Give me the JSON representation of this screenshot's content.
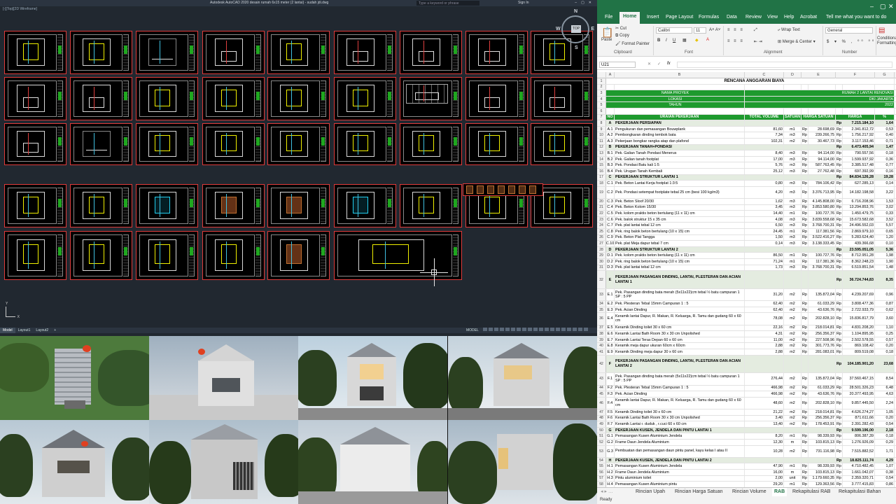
{
  "autocad": {
    "title": "Autodesk AutoCAD 2020   desain rumah 6x15 meter (2 lantai) - sudah jdi.dwg",
    "search_placeholder": "Type a keyword or phrase",
    "user": "Sign In",
    "view_label": "[-][Top][2D Wireframe]",
    "compass": {
      "top": "TOP",
      "n": "N",
      "s": "S",
      "e": "E",
      "w": "W"
    },
    "ucs_x": "X",
    "ucs_y": "Y",
    "layout_tabs": [
      "Model",
      "Layout1",
      "Layout2",
      "+"
    ],
    "model_label": "MODEL"
  },
  "excel": {
    "tabs": [
      "File",
      "Home",
      "Insert",
      "Page Layout",
      "Formulas",
      "Data",
      "Review",
      "View",
      "Help",
      "Acrobat",
      "Tell me what you want to do"
    ],
    "ribbon": {
      "cut": "Cut",
      "copy": "Copy",
      "format_painter": "Format Painter",
      "paste": "Paste",
      "clipboard": "Clipboard",
      "font_name": "Calibri",
      "font_size": "11",
      "font": "Font",
      "bold": "B",
      "italic": "I",
      "underline": "U",
      "alignment": "Alignment",
      "wrap_text": "Wrap Text",
      "merge_center": "Merge & Center",
      "number_format": "General",
      "number": "Number",
      "conditional": "Conditional Formatting"
    },
    "name_box": "U21",
    "fx": "fx",
    "columns": [
      "A",
      "B",
      "C",
      "D",
      "E",
      "F",
      "G"
    ],
    "sheet_tabs": [
      "Rincian Upah",
      "Rincian Harga Satuan",
      "Rincian Volume",
      "RAB",
      "Rekapitulasi RAB",
      "Rekapitulasi Bahan"
    ],
    "status": "Ready",
    "rows": [
      {
        "n": "1",
        "kind": "t",
        "b": "RENCANA ANGGARAN BIAYA"
      },
      {
        "n": "2",
        "kind": ""
      },
      {
        "n": "3",
        "kind": "g",
        "a": "NAMA PROYEK",
        "b": "",
        "c": "RUMAH 2 LANTAI RENOVASI"
      },
      {
        "n": "4",
        "kind": "g",
        "a": "LOKASI",
        "b": "",
        "c": "DKI JAKARTA"
      },
      {
        "n": "5",
        "kind": "g",
        "a": "TAHUN",
        "b": "",
        "c": "2022"
      },
      {
        "n": "6",
        "kind": ""
      },
      {
        "n": "7",
        "kind": "h",
        "a": "NO",
        "b": "URAIAN PEKERJAAN",
        "c": "TOTAL VOLUME",
        "d": "SATUAN",
        "e": "HARGA SATUAN",
        "f": "HARGA",
        "g": "%"
      },
      {
        "n": "8",
        "kind": "s",
        "a": "A",
        "b": "PEKERJAAN PERSIAPAN",
        "e": "",
        "rp2": "Rp",
        "f": "7.215.184,10",
        "g": "1,64"
      },
      {
        "n": "9",
        "a": "A.1",
        "b": "Pengukuran dan pemasangan Bouwplank",
        "c": "81,60",
        "d": "m1",
        "rp": "Rp",
        "e": "28.698,69",
        "rp2": "Rp",
        "f": "2.341.812,72",
        "g": "0,53"
      },
      {
        "n": "10",
        "a": "A.2",
        "b": "Pembongkaran dinding tembok bata",
        "c": "7,34",
        "d": "m3",
        "rp": "Rp",
        "e": "239.266,75",
        "rp2": "Rp",
        "f": "1.756.217,92",
        "g": "0,40"
      },
      {
        "n": "11",
        "a": "A.3",
        "b": "Pekerjaan bongkar rangka atap dan plafond",
        "c": "102,31",
        "d": "m2",
        "rp": "Rp",
        "e": "30.467,73",
        "rp2": "Rp",
        "f": "3.117.153,46",
        "g": "0,71"
      },
      {
        "n": "12",
        "kind": "s",
        "a": "B",
        "b": "PEKERJAAN TANAH+PONDASI",
        "rp2": "Rp",
        "f": "6.473.405,94",
        "g": "1,47"
      },
      {
        "n": "13",
        "a": "B.1",
        "b": "Pek. Galian Tanah Pondasi Menerus",
        "c": "8,40",
        "d": "m3",
        "rp": "Rp",
        "e": "94.114,00",
        "rp2": "Rp",
        "f": "790.557,56",
        "g": "0,18"
      },
      {
        "n": "14",
        "a": "B.2",
        "b": "Pek. Galian tanah footplat",
        "c": "17,00",
        "d": "m3",
        "rp": "Rp",
        "e": "94.114,00",
        "rp2": "Rp",
        "f": "1.599.937,92",
        "g": "0,36"
      },
      {
        "n": "15",
        "a": "B.3",
        "b": "Pek. Pondasi Batu kali 1:5",
        "c": "5,76",
        "d": "m3",
        "rp": "Rp",
        "e": "587.763,45",
        "rp2": "Rp",
        "f": "3.385.517,48",
        "g": "0,77"
      },
      {
        "n": "16",
        "a": "B.4",
        "b": "Pek. Urugan Tanah Kembali",
        "c": "25,12",
        "d": "m3",
        "rp": "Rp",
        "e": "27.762,48",
        "rp2": "Rp",
        "f": "697.392,99",
        "g": "0,16"
      },
      {
        "n": "17",
        "kind": "s",
        "a": "C",
        "b": "PEKERJAAN STRUKTUR LANTAI 1",
        "rp2": "Rp",
        "f": "84.834.126,28",
        "g": "19,28"
      },
      {
        "n": "18",
        "a": "C.1",
        "b": "Pek. Beton Lantai Kerja footplat 1:3:5",
        "c": "0,80",
        "d": "m3",
        "rp": "Rp",
        "e": "784.106,42",
        "rp2": "Rp",
        "f": "627.285,13",
        "g": "0,14"
      },
      {
        "n": "19",
        "kind": "wrap",
        "h": 2,
        "a": "C.2",
        "b": "Pek. Pondasi setempat footplate tebal 25 cm (besi 100 kg/m3)",
        "c": "4,20",
        "d": "m3",
        "rp": "Rp",
        "e": "3.376.713,95",
        "rp2": "Rp",
        "f": "14.182.198,58",
        "g": "3,22"
      },
      {
        "n": "20",
        "a": "C.3",
        "b": "Pek. Beton Sloof 20/30",
        "c": "1,62",
        "d": "m3",
        "rp": "Rp",
        "e": "4.145.808,00",
        "rp2": "Rp",
        "f": "6.716.208,96",
        "g": "1,53"
      },
      {
        "n": "21",
        "a": "C.4",
        "b": "Pek. Beton Kolom 15/30",
        "c": "3,45",
        "d": "m3",
        "rp": "Rp",
        "e": "3.853.580,80",
        "rp2": "Rp",
        "f": "13.294.853,76",
        "g": "3,02"
      },
      {
        "n": "22",
        "a": "C.5",
        "b": "Pek. kolom praktis beton bertulang (11 x 11) cm",
        "c": "14,40",
        "d": "m1",
        "rp": "Rp",
        "e": "100.727,76",
        "rp2": "Rp",
        "f": "1.450.479,75",
        "g": "0,33"
      },
      {
        "n": "23",
        "a": "C.6",
        "b": "Pek. balok struktur 15 x 35 cm",
        "c": "4,08",
        "d": "m3",
        "rp": "Rp",
        "e": "3.839.558,68",
        "rp2": "Rp",
        "f": "15.673.582,68",
        "g": "3,52"
      },
      {
        "n": "24",
        "a": "C.7",
        "b": "Pek. plat lantai tebal 12 cm",
        "c": "6,50",
        "d": "m3",
        "rp": "Rp",
        "e": "3.768.700,31",
        "rp2": "Rp",
        "f": "24.496.552,03",
        "g": "5,57"
      },
      {
        "n": "25",
        "a": "C.8",
        "b": "Pek. ring balok beton bertulang (10 x 15) cm",
        "c": "24,45",
        "d": "m1",
        "rp": "Rp",
        "e": "117.381,56",
        "rp2": "Rp",
        "f": "2.869.979,10",
        "g": "0,65"
      },
      {
        "n": "26",
        "a": "C.9",
        "b": "Pek. Beton Plat Tangga",
        "c": "1,50",
        "d": "m3",
        "rp": "Rp",
        "e": "3.522.416,27",
        "rp2": "Rp",
        "f": "5.283.624,40",
        "g": "1,20"
      },
      {
        "n": "27",
        "a": "C.10",
        "b": "Pek. plat Meja dapur tebal 7 cm",
        "c": "0,14",
        "d": "m3",
        "rp": "Rp",
        "e": "3.138.333,45",
        "rp2": "Rp",
        "f": "439.366,68",
        "g": "0,10"
      },
      {
        "n": "28",
        "kind": "s",
        "a": "D",
        "b": "PEKERJAAN STRUKTUR LANTAI 2",
        "rp2": "Rp",
        "f": "23.595.051,05",
        "g": "5,36"
      },
      {
        "n": "29",
        "a": "D.1",
        "b": "Pek. kolom praktis beton bertulang (11 x 11) cm",
        "c": "86,50",
        "d": "m1",
        "rp": "Rp",
        "e": "100.727,76",
        "rp2": "Rp",
        "f": "8.712.951,28",
        "g": "1,98"
      },
      {
        "n": "30",
        "a": "D.2",
        "b": "Pek. ring balok beton bertulang (10 x 15) cm",
        "c": "71,24",
        "d": "m1",
        "rp": "Rp",
        "e": "117.381,36",
        "rp2": "Rp",
        "f": "8.362.248,23",
        "g": "1,90"
      },
      {
        "n": "31",
        "a": "D.3",
        "b": "Pek. plat lantai tebal 12 cm",
        "c": "1,73",
        "d": "m3",
        "rp": "Rp",
        "e": "3.768.700,31",
        "rp2": "Rp",
        "f": "6.519.851,54",
        "g": "1,48"
      },
      {
        "n": "32",
        "kind": "s wrap",
        "h": 3,
        "a": "E",
        "b": "PEKERJAAN PASANGAN DINDING, LANTAI, PLESTERAN DAN ACIAN LANTAI 1",
        "rp2": "Rp",
        "f": "36.724.744,83",
        "g": "8,35"
      },
      {
        "n": "33",
        "kind": "wrap",
        "h": 2,
        "a": "E.1",
        "b": "Pek. Pasangan dinding bata merah (5x11x22)cm tebal ½ batu campuran 1 SP : 5 PP",
        "c": "31,20",
        "d": "m2",
        "rp": "Rp",
        "e": "135.872,04",
        "rp2": "Rp",
        "f": "4.239.207,69",
        "g": "0,96"
      },
      {
        "n": "34",
        "a": "E.2",
        "b": "Pek. Plesteran Tebal 15mm Campuran 1 : 5",
        "c": "62,40",
        "d": "m2",
        "rp": "Rp",
        "e": "61.033,29",
        "rp2": "Rp",
        "f": "3.808.477,36",
        "g": "0,87"
      },
      {
        "n": "35",
        "a": "E.3",
        "b": "Pek. Acian Dinding",
        "c": "62,40",
        "d": "m2",
        "rp": "Rp",
        "e": "43.636,76",
        "rp2": "Rp",
        "f": "2.722.933,79",
        "g": "0,62"
      },
      {
        "n": "36",
        "kind": "wrap",
        "h": 2,
        "a": "E.4",
        "b": "Keramik lantai Dapur, R. Makan, R. Keluarga, R. Tamu dan gudang 60 x 60 cm",
        "c": "78,08",
        "d": "m2",
        "rp": "Rp",
        "e": "202.828,10",
        "rp2": "Rp",
        "f": "15.836.817,79",
        "g": "3,60"
      },
      {
        "n": "37",
        "a": "E.5",
        "b": "Keramik Dinding toilet 30 x 60 cm",
        "c": "22,16",
        "d": "m2",
        "rp": "Rp",
        "e": "218.014,81",
        "rp2": "Rp",
        "f": "4.831.208,20",
        "g": "1,10"
      },
      {
        "n": "38",
        "a": "E.6",
        "b": "Keramik Lantai Bath Room  30 x 30 cm Unpolished",
        "c": "4,31",
        "d": "m2",
        "rp": "Rp",
        "e": "256.356,37",
        "rp2": "Rp",
        "f": "1.104.895,95",
        "g": "0,25"
      },
      {
        "n": "39",
        "a": "E.7",
        "b": "Keramik Lantai Teras Depan  60 x 60 cm",
        "c": "11,00",
        "d": "m2",
        "rp": "Rp",
        "e": "227.508,96",
        "rp2": "Rp",
        "f": "2.502.578,55",
        "g": "0,57"
      },
      {
        "n": "40",
        "a": "E.8",
        "b": "Keramik meja dapur ukuran 60cm x 60cm",
        "c": "2,88",
        "d": "m2",
        "rp": "Rp",
        "e": "301.773,76",
        "rp2": "Rp",
        "f": "869.108,42",
        "g": "0,20"
      },
      {
        "n": "41",
        "a": "E.9",
        "b": "Keramik Dinding meja dapur  30 x 60 cm",
        "c": "2,88",
        "d": "m2",
        "rp": "Rp",
        "e": "281.083,01",
        "rp2": "Rp",
        "f": "809.519,08",
        "g": "0,18"
      },
      {
        "n": "42",
        "kind": "s wrap",
        "h": 3,
        "a": "F",
        "b": "PEKERJAAN PASANGAN DINDING, LANTAI, PLESTERAN DAN ACIAN LANTAI 2",
        "rp2": "Rp",
        "f": "104.185.901,20",
        "g": "23,68"
      },
      {
        "n": "43",
        "kind": "wrap",
        "h": 2,
        "a": "F.1",
        "b": "Pek. Pasangan dinding bata merah (5x11x22)cm tebal ½ batu campuran 1 SP : 5 PP",
        "c": "276,44",
        "d": "m2",
        "rp": "Rp",
        "e": "135.872,04",
        "rp2": "Rp",
        "f": "37.560.467,15",
        "g": "8,54"
      },
      {
        "n": "44",
        "a": "F.2",
        "b": "Pek. Plesteran Tebal 15mm Campuran 1 : 5",
        "c": "466,98",
        "d": "m2",
        "rp": "Rp",
        "e": "61.033,29",
        "rp2": "Rp",
        "f": "28.501.326,23",
        "g": "6,48"
      },
      {
        "n": "45",
        "a": "F.3",
        "b": "Pek. Acian Dinding",
        "c": "466,98",
        "d": "m2",
        "rp": "Rp",
        "e": "43.636,76",
        "rp2": "Rp",
        "f": "20.377.493,95",
        "g": "4,63"
      },
      {
        "n": "46",
        "kind": "wrap",
        "h": 2,
        "a": "F.4",
        "b": "Keramik lantai Dapur, R. Makan, R. Keluarga, R. Tamu dan gudang 60 x 60 cm",
        "c": "48,60",
        "d": "m2",
        "rp": "Rp",
        "e": "202.828,10",
        "rp2": "Rp",
        "f": "9.857.445,50",
        "g": "2,24"
      },
      {
        "n": "47",
        "a": "F.5",
        "b": "Keramik Dinding toilet 30 x 60 cm",
        "c": "21,22",
        "d": "m2",
        "rp": "Rp",
        "e": "218.014,81",
        "rp2": "Rp",
        "f": "4.626.274,27",
        "g": "1,05"
      },
      {
        "n": "48",
        "a": "F.6",
        "b": "Keramik Lantai Bath Room  30 x 30 cm Unpolished",
        "c": "3,40",
        "d": "m2",
        "rp": "Rp",
        "e": "256.356,37",
        "rp2": "Rp",
        "f": "871.611,66",
        "g": "0,20"
      },
      {
        "n": "49",
        "a": "F.7",
        "b": "Keramik Lantai r. duduk , r.cuci  60 x 60 cm",
        "c": "13,40",
        "d": "m2",
        "rp": "Rp",
        "e": "178.453,91",
        "rp2": "Rp",
        "f": "2.391.282,43",
        "g": "0,54"
      },
      {
        "n": "50",
        "kind": "s",
        "a": "G",
        "b": "PEKERJAAN KUSEN, JENDELA DAN PINTU LANTAI 1",
        "rp2": "Rp",
        "f": "9.599.196,00",
        "g": "2,18"
      },
      {
        "n": "51",
        "a": "G.1",
        "b": "Pemasangan Kusen Aluminium Jendela",
        "c": "8,20",
        "d": "m1",
        "rp": "Rp",
        "e": "98.339,93",
        "rp2": "Rp",
        "f": "806.387,39",
        "g": "0,18"
      },
      {
        "n": "52",
        "a": "G.2",
        "b": "Frame Daun Jendela Aluminium",
        "c": "12,30",
        "d": "m",
        "rp": "Rp",
        "e": "103.815,13",
        "rp2": "Rp",
        "f": "1.276.926,09",
        "g": "0,29"
      },
      {
        "n": "53",
        "kind": "wrap",
        "h": 2,
        "a": "G.3",
        "b": "Pembuatan dan pemasangan daun pintu panel, kayu kelas I atau II",
        "c": "10,28",
        "d": "m2",
        "rp": "Rp",
        "e": "731.116,98",
        "rp2": "Rp",
        "f": "7.515.882,52",
        "g": "1,71"
      },
      {
        "n": "54",
        "kind": "s",
        "a": "H",
        "b": "PEKERJAAN KUSEN, JENDELA DAN PINTU LANTAI 2",
        "rp2": "Rp",
        "f": "18.825.111,74",
        "g": "4,29"
      },
      {
        "n": "55",
        "a": "H.1",
        "b": "Pemasangan Kusen Aluminium Jendela",
        "c": "47,90",
        "d": "m1",
        "rp": "Rp",
        "e": "98.339,93",
        "rp2": "Rp",
        "f": "4.710.482,45",
        "g": "1,07"
      },
      {
        "n": "56",
        "a": "H.2",
        "b": "Frame Daun Jendela Aluminium",
        "c": "16,00",
        "d": "m",
        "rp": "Rp",
        "e": "103.815,13",
        "rp2": "Rp",
        "f": "1.661.042,07",
        "g": "0,38"
      },
      {
        "n": "57",
        "a": "H.3",
        "b": "Pintu aluminium toilet",
        "c": "2,00",
        "d": "unit",
        "rp": "Rp",
        "e": "1.179.660,35",
        "rp2": "Rp",
        "f": "2.359.320,71",
        "g": "0,54"
      },
      {
        "n": "58",
        "a": "H.4",
        "b": "Pemasangan Kusen Aluminium pintu",
        "c": "29,20",
        "d": "m1",
        "rp": "Rp",
        "e": "129.363,56",
        "rp2": "Rp",
        "f": "3.777.415,83",
        "g": "0,86"
      }
    ]
  }
}
